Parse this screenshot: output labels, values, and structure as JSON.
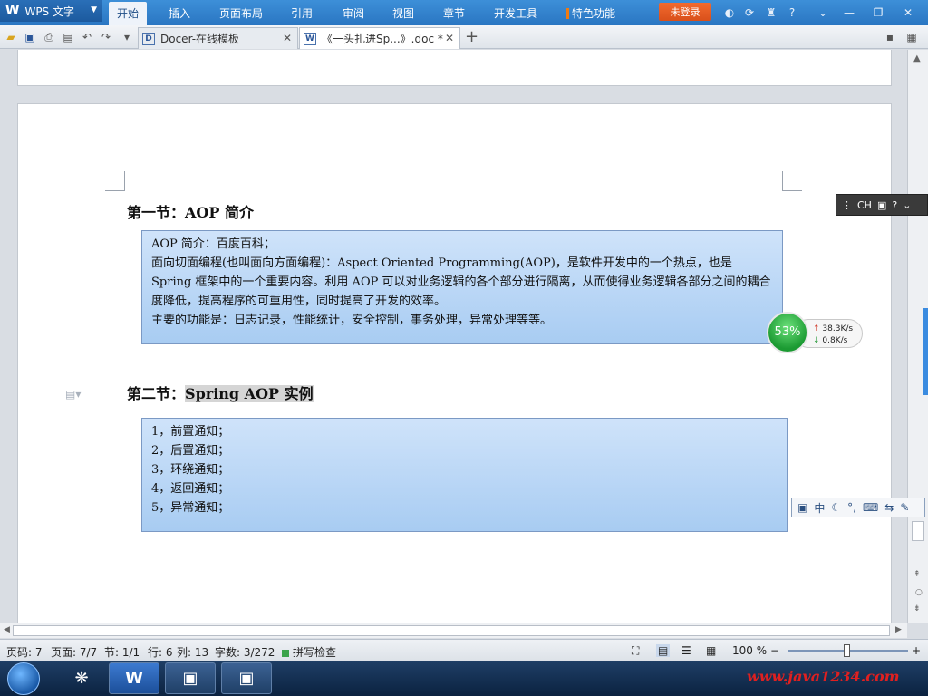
{
  "app": {
    "name": "WPS 文字",
    "logo": "W"
  },
  "menu": {
    "items": [
      "开始",
      "插入",
      "页面布局",
      "引用",
      "审阅",
      "视图",
      "章节",
      "开发工具"
    ],
    "special": "特色功能",
    "login": "未登录"
  },
  "tabs": [
    {
      "icon": "D",
      "label": "Docer-在线模板"
    },
    {
      "icon": "W",
      "label": "《一头扎进Sp...》.doc *"
    }
  ],
  "document": {
    "section1_title": "第一节：AOP 简介",
    "box1": [
      "AOP 简介：百度百科；",
      "面向切面编程(也叫面向方面编程)：Aspect Oriented Programming(AOP)，是软件开发中的一个热点，也是 Spring 框架中的一个重要内容。利用 AOP 可以对业务逻辑的各个部分进行隔离，从而使得业务逻辑各部分之间的耦合度降低，提高程序的可重用性，同时提高了开发的效率。",
      "主要的功能是：日志记录，性能统计，安全控制，事务处理，异常处理等等。"
    ],
    "section2_prefix": "第二节：",
    "section2_highlight": "Spring AOP 实例",
    "box2": [
      "1，前置通知；",
      "2，后置通知；",
      "3，环绕通知；",
      "4，返回通知；",
      "5，异常通知；"
    ]
  },
  "status": {
    "page_code": "页码: 7",
    "page": "页面: 7/7",
    "section": "节: 1/1",
    "row": "行: 6",
    "col": "列: 13",
    "words": "字数: 3/272",
    "spell": "拼写检查",
    "zoom": "100 %"
  },
  "network": {
    "percent": "53%",
    "up": "38.3K/s",
    "down": "0.8K/s"
  },
  "ime": {
    "lang": "CH",
    "mode": "中"
  },
  "watermark": "www.java1234.com",
  "colors": {
    "accent": "#2a76c2",
    "login": "#e85a22",
    "textbox": "#b9d7f5"
  }
}
